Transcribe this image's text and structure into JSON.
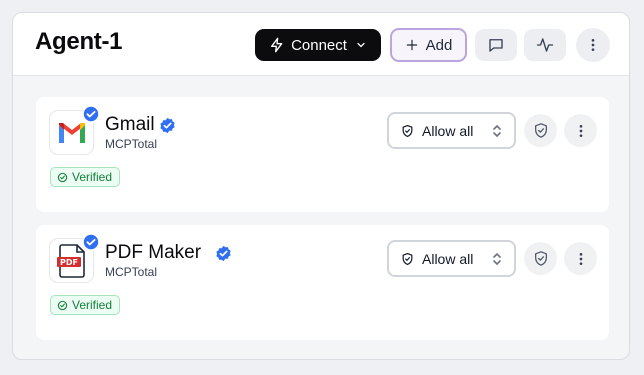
{
  "agent": {
    "title": "Agent-1"
  },
  "toolbar": {
    "connect_label": "Connect",
    "add_label": "Add",
    "icons": [
      "zap-icon",
      "chevron-down-icon",
      "plus-icon",
      "message-icon",
      "activity-icon",
      "more-vertical-icon"
    ]
  },
  "servers": [
    {
      "name": "Gmail",
      "vendor": "MCPTotal",
      "status": "Verified",
      "permission": "Allow all",
      "logo": "gmail-logo"
    },
    {
      "name": "PDF Maker",
      "vendor": "MCPTotal",
      "status": "Verified",
      "permission": "Allow all",
      "logo": "pdf-logo",
      "logo_text": "PDF"
    }
  ],
  "colors": {
    "accent_blue": "#2f6ff0",
    "verified_green": "#15803d",
    "add_border": "#b9a6de",
    "connect_bg": "#0c0c0f"
  }
}
